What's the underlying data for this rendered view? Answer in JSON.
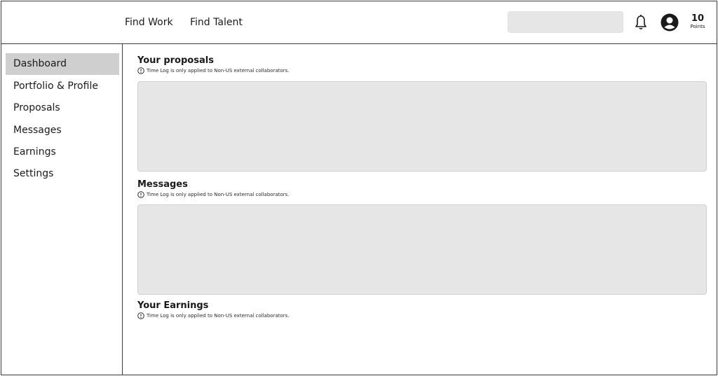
{
  "header": {
    "nav": [
      "Find Work",
      "Find Talent"
    ],
    "search": {
      "placeholder": ""
    },
    "points": {
      "value": "10",
      "label": "Points"
    }
  },
  "sidebar": {
    "items": [
      {
        "label": "Dashboard",
        "active": true
      },
      {
        "label": "Portfolio & Profile",
        "active": false
      },
      {
        "label": "Proposals",
        "active": false
      },
      {
        "label": "Messages",
        "active": false
      },
      {
        "label": "Earnings",
        "active": false
      },
      {
        "label": "Settings",
        "active": false
      }
    ]
  },
  "main": {
    "sections": [
      {
        "title": "Your proposals",
        "note": "Time Log is only applied to Non-US external collaborators."
      },
      {
        "title": "Messages",
        "note": "Time Log is only applied to Non-US external collaborators."
      },
      {
        "title": "Your Earnings",
        "note": "Time Log is only applied to Non-US external collaborators."
      }
    ]
  },
  "icons": {
    "bell": "bell-icon",
    "avatar": "user-avatar-icon",
    "info": "info-icon"
  },
  "colors": {
    "active_item_bg": "#cfcfcf",
    "panel_bg": "#e6e6e6",
    "border": "#3a3a3a"
  }
}
